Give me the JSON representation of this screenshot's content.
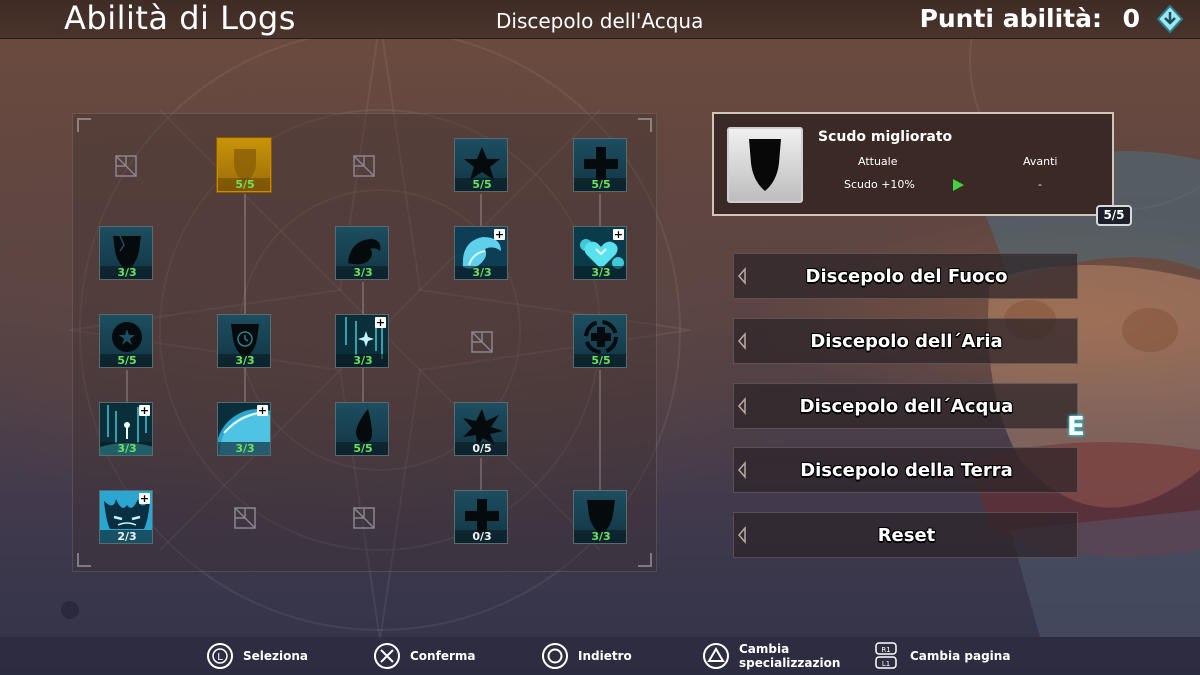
{
  "header": {
    "title": "Abilità di Logs",
    "subtitle": "Discepolo dell'Acqua",
    "points_label": "Punti abilità:",
    "points_value": "0"
  },
  "tree": {
    "nodes": [
      {
        "id": "r1c2",
        "icon": "shield-outline-icon",
        "level": "5/5",
        "selected": true
      },
      {
        "id": "r1c4",
        "icon": "star-icon",
        "level": "5/5"
      },
      {
        "id": "r1c5",
        "icon": "cross-plus-icon",
        "level": "5/5"
      },
      {
        "id": "r2c1",
        "icon": "cracked-shield-icon",
        "level": "3/3"
      },
      {
        "id": "r2c3",
        "icon": "wave-swirl-icon",
        "level": "3/3"
      },
      {
        "id": "r2c4",
        "icon": "water-dragon-icon",
        "level": "3/3",
        "plus": true
      },
      {
        "id": "r2c5",
        "icon": "water-heart-icon",
        "level": "3/3",
        "plus": true
      },
      {
        "id": "r3c1",
        "icon": "star-orb-icon",
        "level": "5/5"
      },
      {
        "id": "r3c2",
        "icon": "timer-shield-icon",
        "level": "3/3"
      },
      {
        "id": "r3c3",
        "icon": "sparkle-rain-icon",
        "level": "3/3",
        "plus": true
      },
      {
        "id": "r3c5",
        "icon": "circle-plus-icon",
        "level": "5/5"
      },
      {
        "id": "r4c1",
        "icon": "rain-drop-icon",
        "level": "3/3",
        "plus": true
      },
      {
        "id": "r4c2",
        "icon": "water-planet-icon",
        "level": "3/3",
        "plus": true
      },
      {
        "id": "r4c3",
        "icon": "water-drop-icon",
        "level": "5/5"
      },
      {
        "id": "r4c4",
        "icon": "burst-icon",
        "level": "0/5"
      },
      {
        "id": "r5c1",
        "icon": "water-monster-icon",
        "level": "2/3",
        "plus": true
      },
      {
        "id": "r5c4",
        "icon": "cross-plus-icon",
        "level": "0/3"
      },
      {
        "id": "r5c5",
        "icon": "shield-icon",
        "level": "3/3"
      }
    ],
    "empty_slots": [
      "r1c1",
      "r1c3",
      "r3c4",
      "r5c2",
      "r5c3"
    ]
  },
  "info_card": {
    "name": "Scudo migliorato",
    "current_header": "Attuale",
    "next_header": "Avanti",
    "current_value": "Scudo +10%",
    "next_value": "-",
    "level_badge": "5/5"
  },
  "menu": [
    {
      "label": "Discepolo del Fuoco"
    },
    {
      "label": "Discepolo dell´Aria"
    },
    {
      "label": "Discepolo dell´Acqua"
    },
    {
      "label": "Discepolo della Terra"
    },
    {
      "label": "Reset"
    }
  ],
  "key_hint": "E",
  "hints": [
    {
      "icon": "left-stick-icon",
      "label": "Seleziona"
    },
    {
      "icon": "cross-button-icon",
      "label": "Conferma"
    },
    {
      "icon": "circle-button-icon",
      "label": "Indietro"
    },
    {
      "icon": "triangle-button-icon",
      "label": "Cambia specializzazion"
    },
    {
      "icon": "r1-l1-buttons-icon",
      "label": "Cambia pagina"
    }
  ],
  "colors": {
    "level_green": "#6be35a",
    "selected_gold": "#c8940a",
    "node_teal": "#1d4e60",
    "arrow_green": "#3fd43f"
  }
}
